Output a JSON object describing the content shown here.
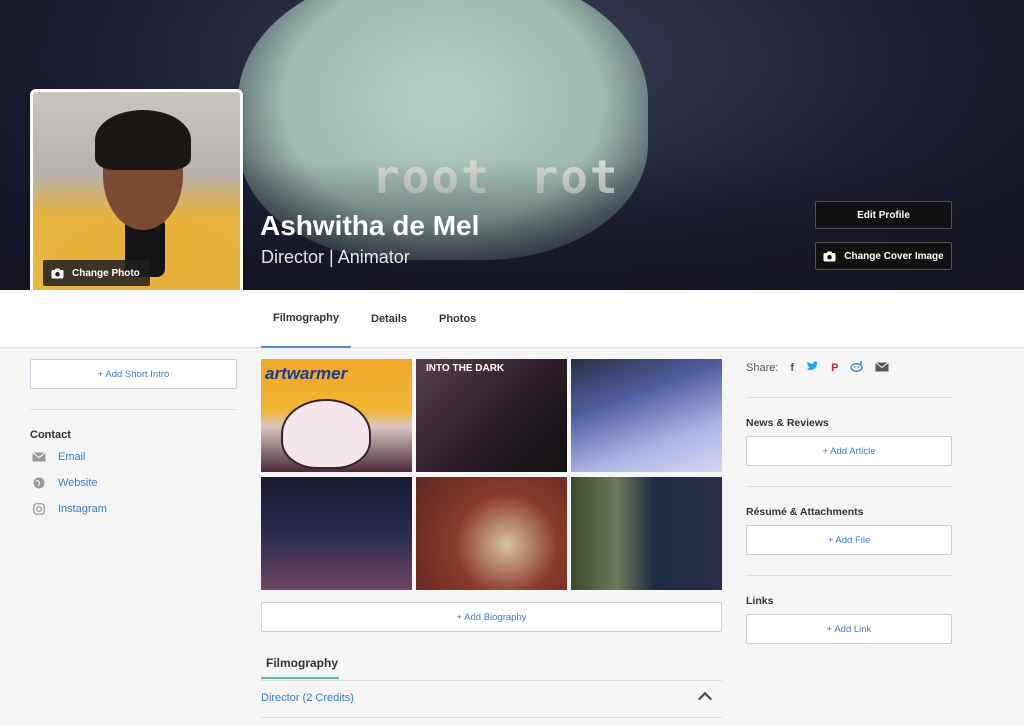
{
  "cover": {
    "title_text": "root rot",
    "change_photo_label": "Change Photo",
    "edit_profile_label": "Edit Profile",
    "change_cover_label": "Change Cover Image"
  },
  "profile": {
    "name": "Ashwitha de Mel",
    "role": "Director | Animator"
  },
  "tabs": [
    {
      "label": "Filmography"
    },
    {
      "label": "Details"
    },
    {
      "label": "Photos"
    }
  ],
  "left": {
    "add_intro_label": "+ Add Short Intro",
    "contact_heading": "Contact",
    "contacts": [
      {
        "label": "Email",
        "icon": "envelope-icon"
      },
      {
        "label": "Website",
        "icon": "globe-icon"
      },
      {
        "label": "Instagram",
        "icon": "instagram-icon"
      }
    ]
  },
  "gallery": {
    "thumb1_text": "artwarmer",
    "thumb2_text": "INTO THE DARK"
  },
  "main": {
    "add_bio_label": "+ Add Biography",
    "filmography_heading": "Filmography",
    "credits_label": "Director (2 Credits)"
  },
  "right": {
    "share_label": "Share:",
    "share_icons": [
      "facebook-icon",
      "twitter-icon",
      "pinterest-icon",
      "reddit-icon",
      "email-icon"
    ],
    "news_heading": "News & Reviews",
    "add_article_label": "+ Add Article",
    "resume_heading": "Résumé & Attachments",
    "add_file_label": "+ Add File",
    "links_heading": "Links",
    "add_link_label": "+ Add Link"
  },
  "colors": {
    "accent": "#3b7bc4",
    "tab_active": "#4a8fd1",
    "section_underline": "#5bb79a"
  }
}
